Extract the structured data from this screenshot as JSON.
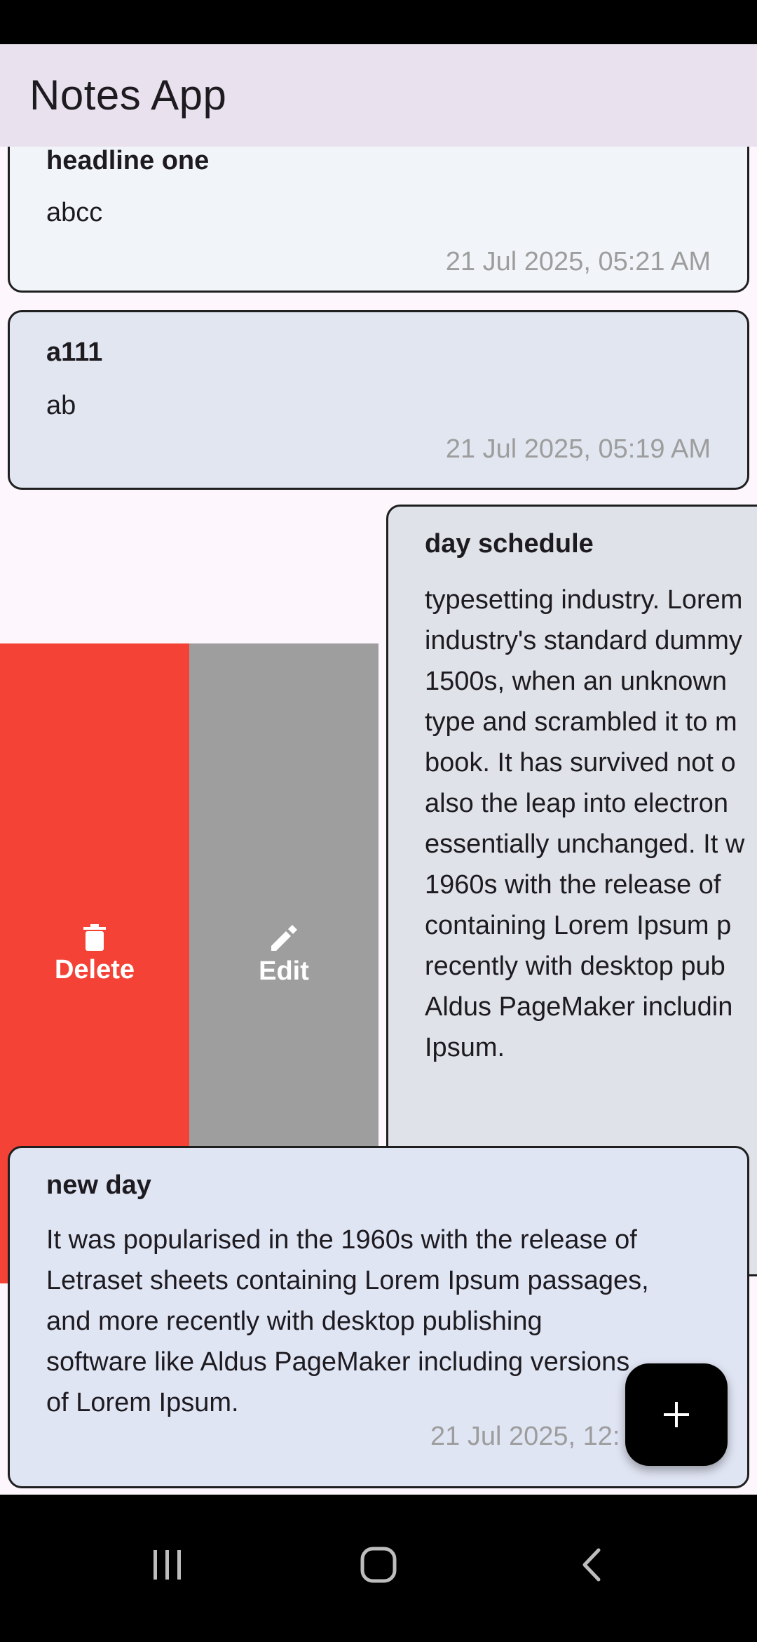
{
  "app": {
    "title": "Notes App"
  },
  "notes": [
    {
      "title": "headline one",
      "body": "abcc",
      "date": "21 Jul 2025, 05:21 AM",
      "color": "#f1f4f8"
    },
    {
      "title": "a111",
      "body": "ab",
      "date": "21 Jul 2025, 05:19 AM",
      "color": "#e1e6f0"
    },
    {
      "title": "day schedule",
      "body_lines": [
        "typesetting industry. Lorem",
        "industry's standard dummy",
        "1500s, when an unknown",
        "type and scrambled it to m",
        "book. It has survived not o",
        "also the leap into electron",
        "essentially unchanged. It w",
        "1960s with the release of",
        "containing Lorem Ipsum p",
        "recently with desktop pub",
        "Aldus PageMaker includin",
        "Ipsum."
      ],
      "color": "#dfe2e8"
    },
    {
      "title": "new day",
      "body_lines": [
        "It was popularised in the 1960s with the release of",
        "Letraset sheets containing Lorem Ipsum passages,",
        "and more recently with desktop publishing",
        "software like Aldus PageMaker including versions",
        "of Lorem Ipsum."
      ],
      "date": "21 Jul 2025, 12:",
      "color": "#e0e5f4"
    }
  ],
  "swipe_actions": {
    "delete_label": "Delete",
    "delete_color": "#f44336",
    "edit_label": "Edit",
    "edit_color": "#9e9e9e"
  },
  "icons": {
    "delete": "trash-icon",
    "edit": "pencil-icon",
    "fab": "plus-icon",
    "nav_recents": "recents-icon",
    "nav_home": "home-icon",
    "nav_back": "back-icon"
  }
}
